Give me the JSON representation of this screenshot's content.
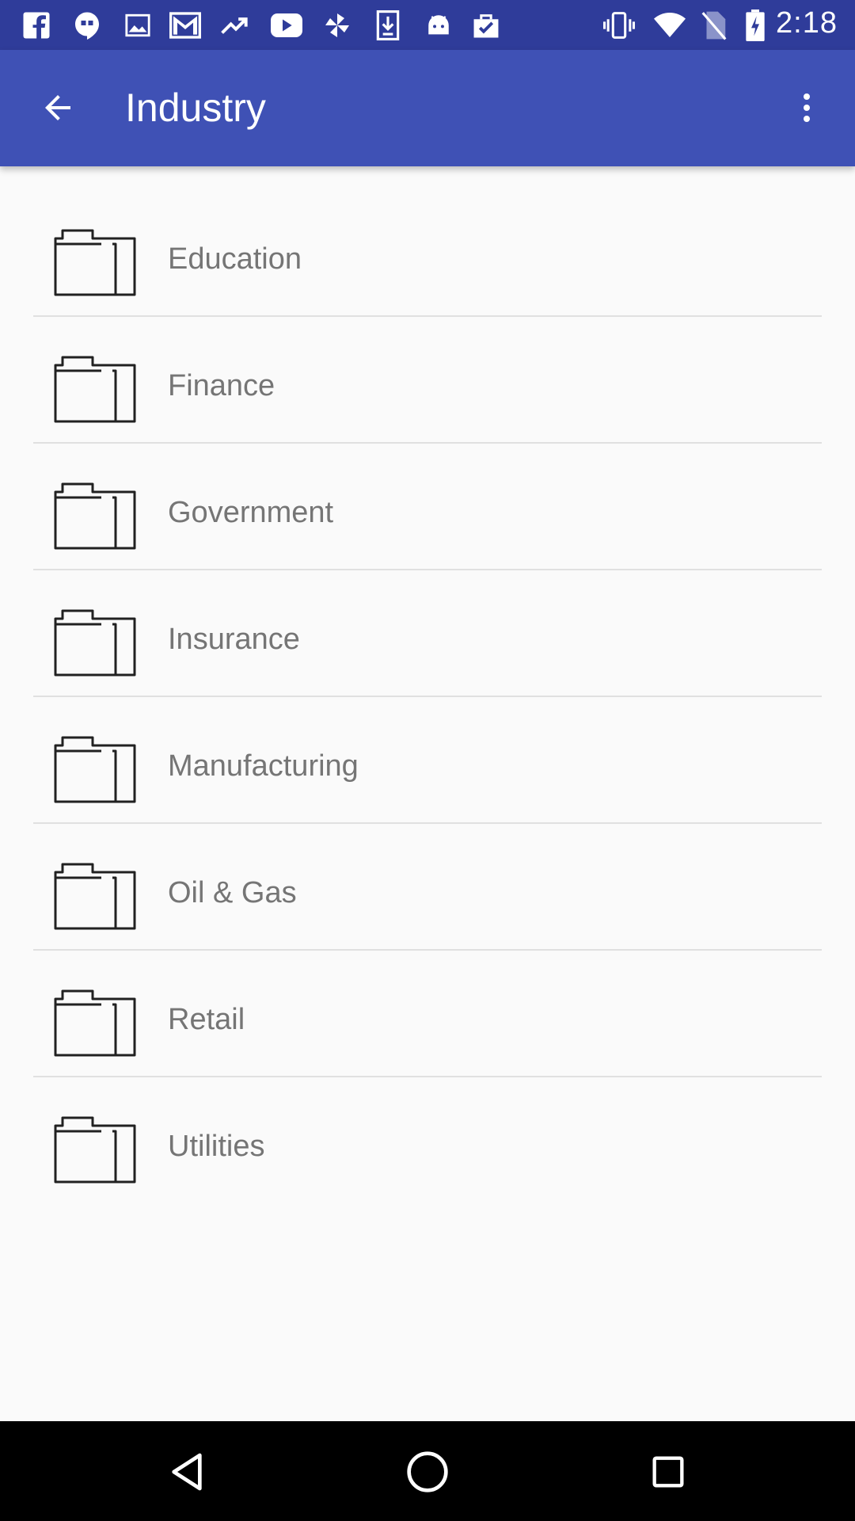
{
  "status_bar": {
    "time": "2:18",
    "left_icons": [
      "facebook-icon",
      "hangouts-icon",
      "image-icon",
      "gmail-icon",
      "trending-icon",
      "youtube-icon",
      "pinwheel-icon",
      "download-icon",
      "android-icon",
      "clipboard-check-icon"
    ],
    "right_icons": [
      "vibrate-icon",
      "wifi-icon",
      "no-sim-icon",
      "battery-charging-icon"
    ]
  },
  "app_bar": {
    "title": "Industry",
    "background": "#3f51b5",
    "status_background": "#2f3c9a"
  },
  "list": {
    "items": [
      {
        "label": "Education",
        "icon": "folder-icon"
      },
      {
        "label": "Finance",
        "icon": "folder-icon"
      },
      {
        "label": "Government",
        "icon": "folder-icon"
      },
      {
        "label": "Insurance",
        "icon": "folder-icon"
      },
      {
        "label": "Manufacturing",
        "icon": "folder-icon"
      },
      {
        "label": "Oil & Gas",
        "icon": "folder-icon"
      },
      {
        "label": "Retail",
        "icon": "folder-icon"
      },
      {
        "label": "Utilities",
        "icon": "folder-icon"
      }
    ]
  },
  "nav_bar": {
    "buttons": [
      "back-triangle-icon",
      "home-circle-icon",
      "recents-square-icon"
    ]
  }
}
